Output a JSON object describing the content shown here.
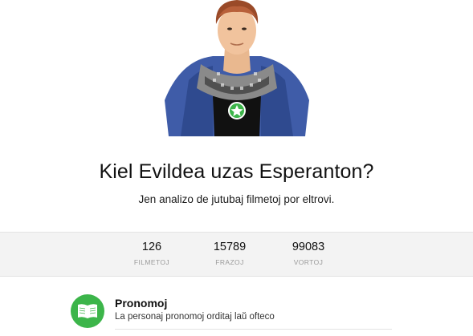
{
  "hero": {
    "title": "Kiel Evildea uzas Esperanton?",
    "subtitle": "Jen analizo de jutubaj filmetoj por eltrovi."
  },
  "stats": [
    {
      "value": "126",
      "label": "FILMETOJ"
    },
    {
      "value": "15789",
      "label": "FRAZOJ"
    },
    {
      "value": "99083",
      "label": "VORTOJ"
    }
  ],
  "features": [
    {
      "title": "Pronomoj",
      "description": "La personaj pronomoj orditaj laŭ ofteco",
      "icon": "book-icon"
    }
  ],
  "colors": {
    "accent": "#3cb54a",
    "stats_bg": "#f3f3f3",
    "label_gray": "#9a9a9a"
  }
}
